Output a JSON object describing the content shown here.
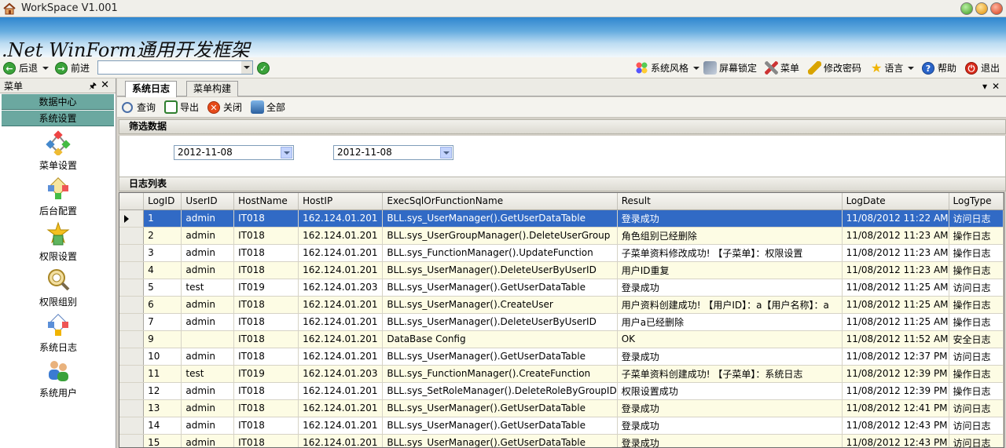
{
  "window": {
    "title": "WorkSpace  V1.001"
  },
  "banner": {
    "logo_text": ".Net WinForm通用开发框架"
  },
  "toolbar": {
    "back_label": "后退",
    "forward_label": "前进",
    "address_value": "",
    "items": [
      {
        "label": "系统风格",
        "icon": "palette-icon"
      },
      {
        "label": "屏幕锁定",
        "icon": "lock-screen-icon"
      },
      {
        "label": "菜单",
        "icon": "tools-icon"
      },
      {
        "label": "修改密码",
        "icon": "pen-icon"
      },
      {
        "label": "语言",
        "icon": "star-icon"
      },
      {
        "label": "帮助",
        "icon": "help-icon"
      },
      {
        "label": "退出",
        "icon": "power-icon"
      }
    ]
  },
  "sidebar": {
    "title": "菜单",
    "categories": [
      "数据中心",
      "系统设置"
    ],
    "items": [
      {
        "label": "菜单设置",
        "icon": "menu-settings-icon"
      },
      {
        "label": "后台配置",
        "icon": "config-icon"
      },
      {
        "label": "权限设置",
        "icon": "permission-icon"
      },
      {
        "label": "权限组别",
        "icon": "permission-group-icon"
      },
      {
        "label": "系统日志",
        "icon": "system-log-icon"
      },
      {
        "label": "系统用户",
        "icon": "users-icon"
      }
    ]
  },
  "tabs": [
    {
      "label": "系统日志",
      "active": true
    },
    {
      "label": "菜单构建",
      "active": false
    }
  ],
  "subtoolbar": {
    "query_label": "查询",
    "export_label": "导出",
    "close_label": "关闭",
    "all_label": "全部"
  },
  "filter": {
    "header": "筛选数据",
    "date_from": "2012-11-08",
    "date_to": "2012-11-08"
  },
  "log_list": {
    "header": "日志列表",
    "columns": [
      "LogID",
      "UserID",
      "HostName",
      "HostIP",
      "ExecSqlOrFunctionName",
      "Result",
      "LogDate",
      "LogType"
    ],
    "rows": [
      [
        "1",
        "admin",
        "IT018",
        "162.124.01.201",
        "BLL.sys_UserManager().GetUserDataTable",
        "登录成功",
        "11/08/2012 11:22 AM",
        "访问日志"
      ],
      [
        "2",
        "admin",
        "IT018",
        "162.124.01.201",
        "BLL.sys_UserGroupManager().DeleteUserGroup",
        "角色组别已经删除",
        "11/08/2012 11:23 AM",
        "操作日志"
      ],
      [
        "3",
        "admin",
        "IT018",
        "162.124.01.201",
        "BLL.sys_FunctionManager().UpdateFunction",
        "子菜单资料修改成功! 【子菜单】：权限设置",
        "11/08/2012 11:23 AM",
        "操作日志"
      ],
      [
        "4",
        "admin",
        "IT018",
        "162.124.01.201",
        "BLL.sys_UserManager().DeleteUserByUserID",
        "用户ID重复",
        "11/08/2012 11:23 AM",
        "操作日志"
      ],
      [
        "5",
        "test",
        "IT019",
        "162.124.01.203",
        "BLL.sys_UserManager().GetUserDataTable",
        "登录成功",
        "11/08/2012 11:25 AM",
        "访问日志"
      ],
      [
        "6",
        "admin",
        "IT018",
        "162.124.01.201",
        "BLL.sys_UserManager().CreateUser",
        "用户资料创建成功! 【用户ID】：a【用户名称】：a",
        "11/08/2012 11:25 AM",
        "操作日志"
      ],
      [
        "7",
        "admin",
        "IT018",
        "162.124.01.201",
        "BLL.sys_UserManager().DeleteUserByUserID",
        "用户a已经删除",
        "11/08/2012 11:25 AM",
        "操作日志"
      ],
      [
        "9",
        "",
        "IT018",
        "162.124.01.201",
        "DataBase Config",
        "OK",
        "11/08/2012 11:52 AM",
        "安全日志"
      ],
      [
        "10",
        "admin",
        "IT018",
        "162.124.01.201",
        "BLL.sys_UserManager().GetUserDataTable",
        "登录成功",
        "11/08/2012 12:37 PM",
        "访问日志"
      ],
      [
        "11",
        "test",
        "IT019",
        "162.124.01.203",
        "BLL.sys_FunctionManager().CreateFunction",
        "子菜单资料创建成功! 【子菜单】：系统日志",
        "11/08/2012 12:39 PM",
        "操作日志"
      ],
      [
        "12",
        "admin",
        "IT018",
        "162.124.01.201",
        "BLL.sys_SetRoleManager().DeleteRoleByGroupID",
        "权限设置成功",
        "11/08/2012 12:39 PM",
        "操作日志"
      ],
      [
        "13",
        "admin",
        "IT018",
        "162.124.01.201",
        "BLL.sys_UserManager().GetUserDataTable",
        "登录成功",
        "11/08/2012 12:41 PM",
        "访问日志"
      ],
      [
        "14",
        "admin",
        "IT018",
        "162.124.01.201",
        "BLL.sys_UserManager().GetUserDataTable",
        "登录成功",
        "11/08/2012 12:43 PM",
        "访问日志"
      ],
      [
        "15",
        "admin",
        "IT018",
        "162.124.01.201",
        "BLL.sys_UserManager().GetUserDataTable",
        "登录成功",
        "11/08/2012 12:43 PM",
        "访问日志"
      ]
    ],
    "selected_row": 0
  },
  "colors": {
    "selection": "#316ac5",
    "row_alt": "#fdfce4",
    "category": "#6ba8a0",
    "banner_top": "#2f86cf"
  }
}
